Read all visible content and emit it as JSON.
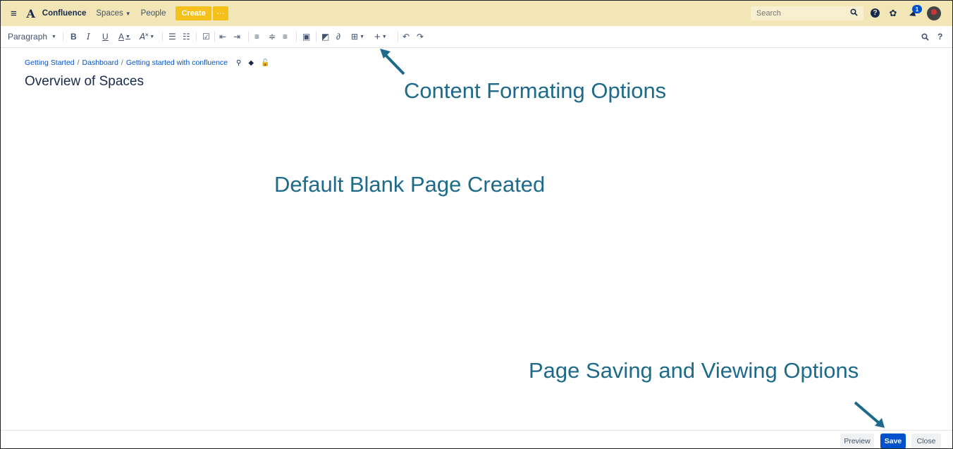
{
  "nav": {
    "brand": "Confluence",
    "spaces": "Spaces",
    "people": "People",
    "create": "Create",
    "more": "···",
    "search_placeholder": "Search",
    "notification_count": "1"
  },
  "toolbar": {
    "paragraph": "Paragraph",
    "bold": "B",
    "italic": "I",
    "underline": "U",
    "text_color": "A",
    "more_format": "A̸"
  },
  "breadcrumb": {
    "items": [
      "Getting Started",
      "Dashboard",
      "Getting started with confluence"
    ]
  },
  "page": {
    "title": "Overview of Spaces"
  },
  "annotations": {
    "formatting": "Content Formating Options",
    "blank": "Default Blank Page Created",
    "saving": "Page Saving and Viewing Options"
  },
  "actions": {
    "preview": "Preview",
    "save": "Save",
    "close": "Close"
  },
  "colors": {
    "nav_bg": "#f3e6b6",
    "create_btn": "#f6c01a",
    "save_btn": "#0052cc",
    "annotation": "#1d6a8a"
  }
}
